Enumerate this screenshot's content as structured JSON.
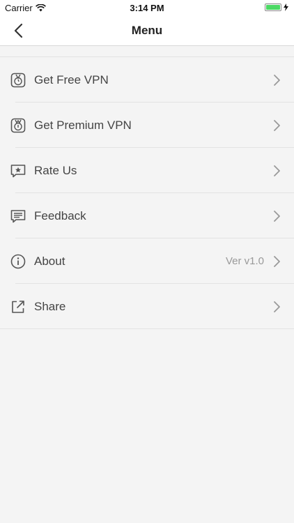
{
  "status": {
    "carrier": "Carrier",
    "time": "3:14 PM"
  },
  "nav": {
    "title": "Menu"
  },
  "menu": [
    {
      "label": "Get Free VPN",
      "detail": "",
      "icon": "vpn-shield-icon"
    },
    {
      "label": "Get Premium VPN",
      "detail": "",
      "icon": "vpn-premium-icon"
    },
    {
      "label": "Rate Us",
      "detail": "",
      "icon": "rate-star-icon"
    },
    {
      "label": "Feedback",
      "detail": "",
      "icon": "feedback-bubble-icon"
    },
    {
      "label": "About",
      "detail": "Ver v1.0",
      "icon": "info-icon"
    },
    {
      "label": "Share",
      "detail": "",
      "icon": "share-icon"
    }
  ],
  "colors": {
    "battery": "#4cd964",
    "background": "#f4f4f4"
  }
}
